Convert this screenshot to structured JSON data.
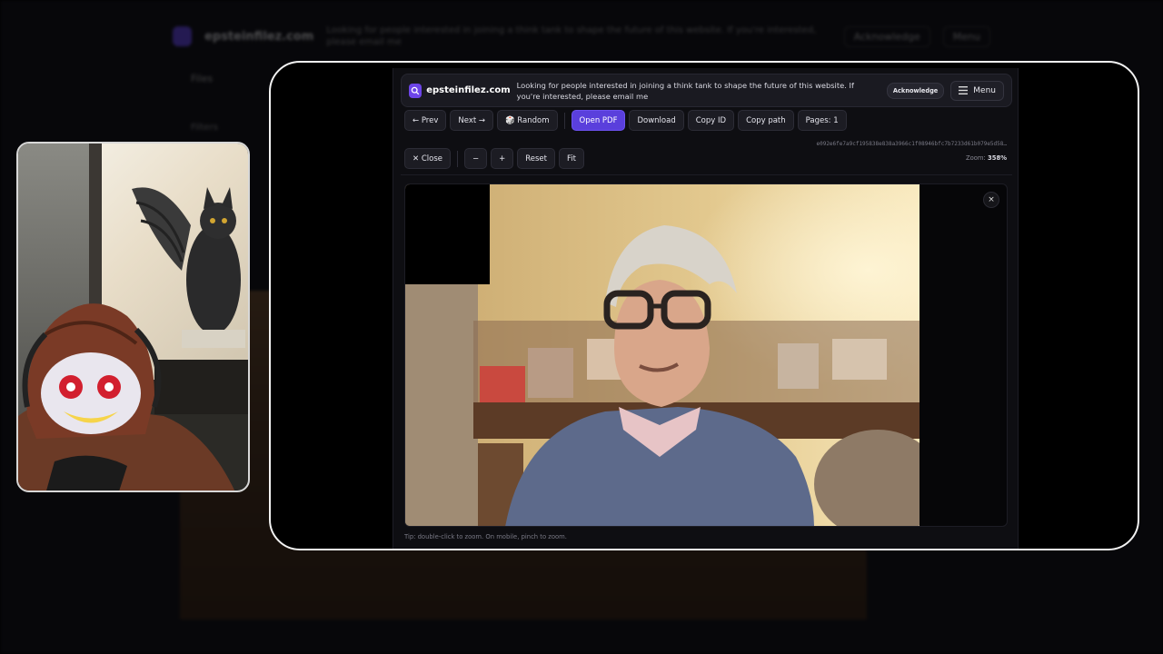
{
  "background": {
    "brand": "epsteinfilez.com",
    "notice": "Looking for people interested in joining a think tank to shape the future of this website. If you're interested, please email me",
    "btn1": "Acknowledge",
    "btn2": "Menu",
    "tab": "Files",
    "side": "Filters"
  },
  "header": {
    "brand": "epsteinfilez.com",
    "notice": "Looking for people interested in joining a think tank to shape the future of this website. If you're interested, please email me",
    "acknowledge_label": "Acknowledge",
    "menu_label": "Menu"
  },
  "toolbar": {
    "prev_label": "← Prev",
    "next_label": "Next →",
    "random_label": "🎲 Random",
    "open_pdf_label": "Open PDF",
    "download_label": "Download",
    "copy_id_label": "Copy ID",
    "copy_path_label": "Copy path",
    "pages_label": "Pages: 1",
    "hash": "e092e6fe7a9cf195838e838a3966c1f08946bfc7b7233d61b079e5d58…"
  },
  "viewer": {
    "close_label": "✕ Close",
    "zoom_out_label": "−",
    "zoom_in_label": "+",
    "reset_label": "Reset",
    "fit_label": "Fit",
    "zoom_prefix": "Zoom:",
    "zoom_value": "358%",
    "dismiss_label": "×",
    "tip": "Tip: double-click to zoom. On mobile, pinch to zoom."
  },
  "colors": {
    "accent": "#5a3fdc",
    "panel": "#0e0e12",
    "frame_border": "#f2f2f2"
  },
  "icons": {
    "logo": "search-icon",
    "menu": "hamburger-icon",
    "random": "dice-icon"
  }
}
